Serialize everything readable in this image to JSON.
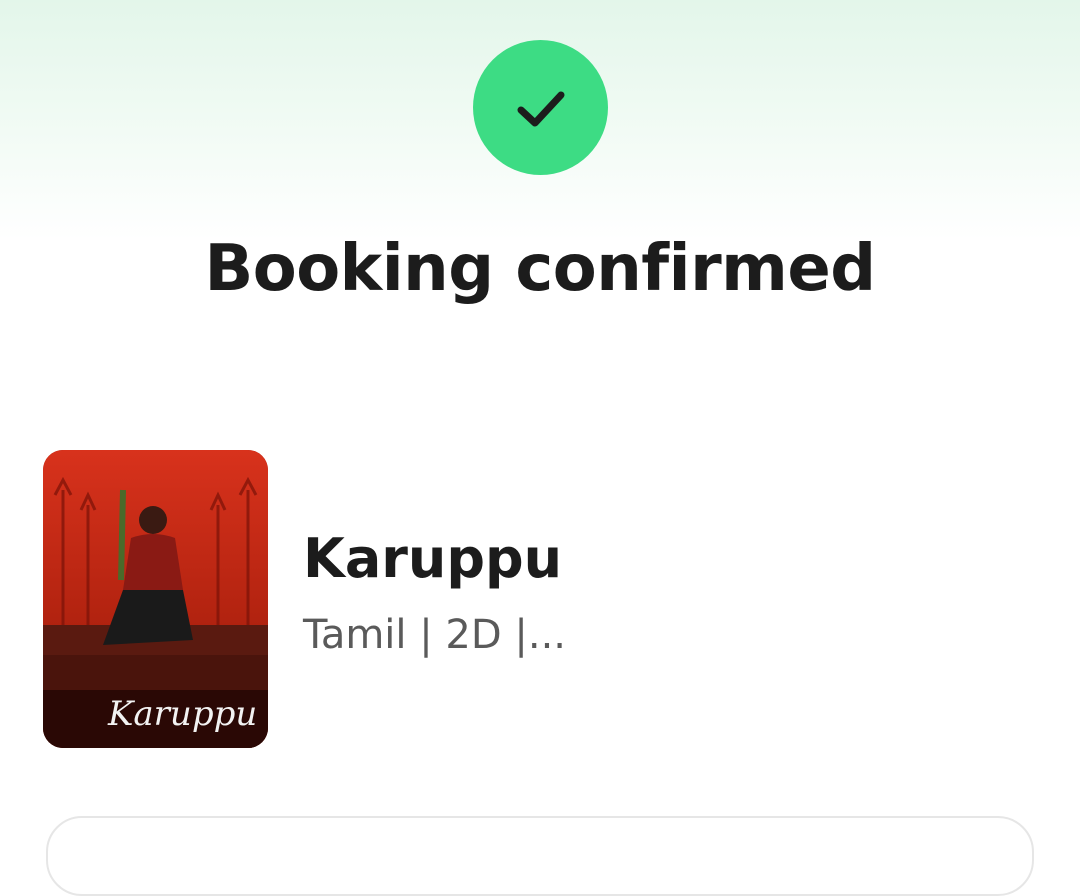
{
  "header": {
    "status_icon": "check-icon",
    "accent_color": "#3ddc84",
    "title": "Booking confirmed"
  },
  "movie": {
    "poster_logo_text": "Karuppu",
    "title": "Karuppu",
    "meta": "Tamil | 2D |..."
  }
}
